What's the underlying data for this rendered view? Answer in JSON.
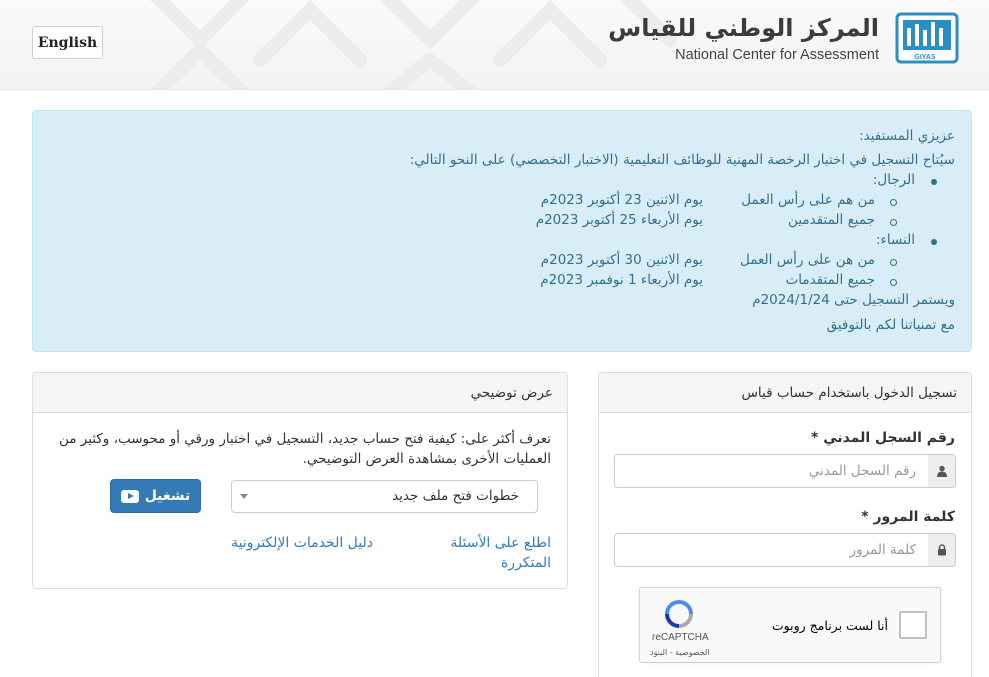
{
  "header": {
    "lang_button": "English",
    "logo_ar": "المركز الوطني للقياس",
    "logo_en": "National Center for Assessment",
    "logo_mark_text": "GIYAS"
  },
  "alert": {
    "greeting": "عزيزي المستفيد:",
    "intro": "سيُتاح التسجيل في اختبار الرخصة المهنية للوظائف التعليمية (الاختبار التخصصي) على النحو التالي:",
    "men_label": "الرجال:",
    "men_items": [
      {
        "who": "من هم على رأس العمل",
        "date": "يوم الاثنين 23 أكتوبر 2023م"
      },
      {
        "who": "جميع المتقدمين",
        "date": "يوم الأربعاء 25 أكتوبر 2023م"
      }
    ],
    "women_label": "النساء:",
    "women_items": [
      {
        "who": "من هن على رأس العمل",
        "date": "يوم الاثنين 30 أكتوبر 2023م"
      },
      {
        "who": "جميع المتقدمات",
        "date": "يوم الأربعاء 1 نوفمبر 2023م"
      }
    ],
    "continues": "ويستمر التسجيل حتى 2024/1/24م",
    "wishes": "مع تمنياتنا لكم بالتوفيق"
  },
  "demo_panel": {
    "title": "عرض توضيحي",
    "description": "تعرف أكثر على: كيفية فتح حساب جديد، التسجيل في اختبار ورقي أو محوسب، وكثير من العمليات الأخرى بمشاهدة العرض التوضيحي.",
    "select_value": "خطوات فتح ملف جديد",
    "play_label": "تشغيل",
    "faq_link": "اطلع على الأسئلة المتكررة",
    "guide_link": "دليل الخدمات الإلكترونية"
  },
  "login_panel": {
    "title": "تسجيل الدخول باستخدام حساب قياس",
    "id_label": "رقم السجل المدني *",
    "id_placeholder": "رقم السجل المدني",
    "password_label": "كلمة المرور *",
    "password_placeholder": "كلمة المرور",
    "captcha_label": "أنا لست برنامج روبوت",
    "captcha_brand": "reCAPTCHA",
    "captcha_terms": "الخصوصية - البنود"
  },
  "colors": {
    "alert_bg": "#d9edf7",
    "alert_text": "#31708f",
    "primary": "#337ab7"
  }
}
